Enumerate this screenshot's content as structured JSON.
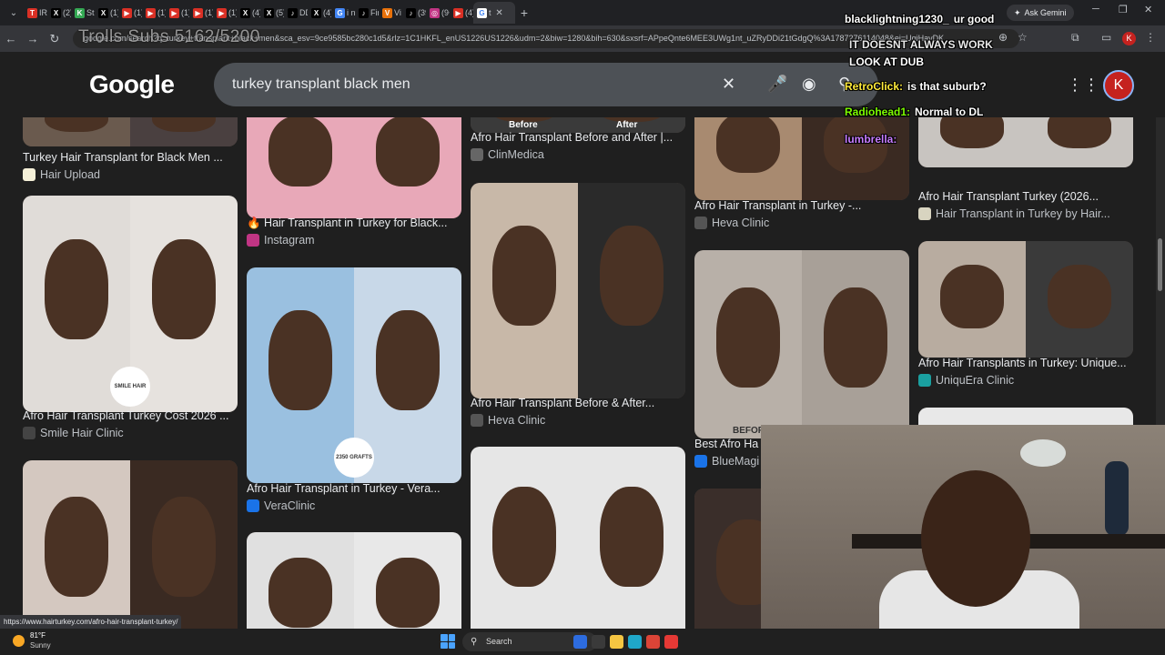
{
  "browser": {
    "tabs": [
      {
        "label": "IRLTo",
        "color": "#d93025",
        "glyph": "T"
      },
      {
        "label": "(2) H",
        "color": "#000000",
        "glyph": "X"
      },
      {
        "label": "St",
        "color": "#34a853",
        "glyph": "K"
      },
      {
        "label": "(1)",
        "color": "#000000",
        "glyph": "X"
      },
      {
        "label": "(1) H",
        "color": "#d93025",
        "glyph": "▶"
      },
      {
        "label": "(1)",
        "color": "#d93025",
        "glyph": "▶"
      },
      {
        "label": "(1) D",
        "color": "#d93025",
        "glyph": "▶"
      },
      {
        "label": "(1) Sh",
        "color": "#d93025",
        "glyph": "▶"
      },
      {
        "label": "(1) D",
        "color": "#d93025",
        "glyph": "▶"
      },
      {
        "label": "(4) D",
        "color": "#000000",
        "glyph": "X"
      },
      {
        "label": "(5) D",
        "color": "#000000",
        "glyph": "X"
      },
      {
        "label": "DDG",
        "color": "#000000",
        "glyph": "♪"
      },
      {
        "label": "(4) le",
        "color": "#000000",
        "glyph": "X"
      },
      {
        "label": "i nee",
        "color": "#4285f4",
        "glyph": "G"
      },
      {
        "label": "Find",
        "color": "#000000",
        "glyph": "♪"
      },
      {
        "label": "Vi",
        "color": "#e8710a",
        "glyph": "V"
      },
      {
        "label": "(39)",
        "color": "#000000",
        "glyph": "♪"
      },
      {
        "label": "(9+)",
        "color": "#c13584",
        "glyph": "◎"
      },
      {
        "label": "(4) D",
        "color": "#d93025",
        "glyph": "▶"
      }
    ],
    "active_tab": {
      "label": "t",
      "glyph": "G"
    },
    "gemini_label": "Ask Gemini",
    "url": "google.com/search?q=turkey+transplant+black+men&sca_esv=9ce9585bc280c1d5&rlz=1C1HKFL_enUS1226US1226&udm=2&biw=1280&bih=630&sxsrf=APpeQnte6MEE3UWg1nt_uZRyDDi21tGdgQ%3A1787276114048&ei=UqiHavDK",
    "profile_initial": "K"
  },
  "overlay": {
    "subs_text": "Trolls Subs 5162/5200",
    "chat": [
      {
        "user": "blacklightning1230_",
        "msg": "ur good",
        "user_color": "#ffffff",
        "msg_color": "#ffffff"
      },
      {
        "user": "",
        "msg": "IT DOESNT ALWAYS WORK",
        "user_color": "#ffffff",
        "msg_color": "#e8e8e8"
      },
      {
        "user": "",
        "msg": "LOOK AT DUB",
        "user_color": "#ffffff",
        "msg_color": "#ffffff"
      },
      {
        "user": "RetroClick:",
        "msg": "is that suburb?",
        "user_color": "#ffeb3b",
        "msg_color": "#ffffff"
      },
      {
        "user": "Radiohead1:",
        "msg": "Normal to DL",
        "user_color": "#7CFC00",
        "msg_color": "#ffffff"
      },
      {
        "user": "lumbrella:",
        "msg": "",
        "user_color": "#c77dff",
        "msg_color": "#ffffff"
      }
    ]
  },
  "google": {
    "logo": "Google",
    "query": "turkey transplant black men",
    "clear_icon": "✕",
    "mic_icon": "🎤",
    "lens_icon": "◉",
    "apps_icon": "⋮⋮⋮",
    "avatar": "K"
  },
  "results": [
    {
      "caption": "Turkey Hair Transplant for Black Men ...",
      "source": "Hair Upload",
      "src_color": "#f5f0d8",
      "tones": [
        "#6a5a4e",
        "#4a4040"
      ]
    },
    {
      "caption": "Afro Hair Transplant Turkey Cost 2026 ...",
      "source": "Smile Hair Clinic",
      "src_color": "#444444",
      "tones": [
        "#e0dcd8",
        "#e6e2de"
      ],
      "badge": "SMILE HAIR CLINIC"
    },
    {
      "caption": "",
      "source": "",
      "src_color": "#000000",
      "tones": [
        "#d4c8c0",
        "#3a2a22"
      ]
    },
    {
      "caption": "🔥 Hair Transplant in Turkey for Black...",
      "source": "Instagram",
      "src_color": "#c13584",
      "tones": [
        "#e8a8b8",
        "#e8a8b8"
      ]
    },
    {
      "caption": "Afro Hair Transplant in Turkey - Vera...",
      "source": "VeraClinic",
      "src_color": "#1a73e8",
      "tones": [
        "#9ac0e0",
        "#c8d8e8"
      ],
      "badge": "2350 GRAFTS"
    },
    {
      "caption": "",
      "source": "",
      "src_color": "#000000",
      "tones": [
        "#e0e0e0",
        "#e8e8e8"
      ]
    },
    {
      "caption": "Afro Hair Transplant Before and After |...",
      "source": "ClinMedica",
      "src_color": "#666666",
      "tones": [
        "#3a3a3a",
        "#3a3a3a"
      ],
      "labels": [
        "Before",
        "After"
      ]
    },
    {
      "caption": "Afro Hair Transplant Before & After...",
      "source": "Heva Clinic",
      "src_color": "#555555",
      "tones": [
        "#c8b8a8",
        "#2a2a2a"
      ]
    },
    {
      "caption": "",
      "source": "",
      "src_color": "#000000",
      "tones": [
        "#e6e6e6",
        "#e6e6e6"
      ]
    },
    {
      "caption": "Afro Hair Transplant in Turkey -...",
      "source": "Heva Clinic",
      "src_color": "#555555",
      "tones": [
        "#a88a70",
        "#3a2a22"
      ]
    },
    {
      "caption": "Best Afro Ha",
      "source": "BlueMagi",
      "src_color": "#1a73e8",
      "tones": [
        "#b8b0a8",
        "#a8a098"
      ],
      "labels": [
        "BEFORE",
        "AFTER"
      ]
    },
    {
      "caption": "",
      "source": "",
      "src_color": "#000000",
      "tones": [
        "#3a2e2a",
        "#2a2a2a"
      ]
    },
    {
      "caption": "Afro Hair Transplant Turkey (2026...",
      "source": "Hair Transplant in Turkey by Hair...",
      "src_color": "#d8d4c0",
      "tones": [
        "#c8c4c0",
        "#c8c4c0"
      ]
    },
    {
      "caption": "Afro Hair Transplants in Turkey: Unique...",
      "source": "UniquEra Clinic",
      "src_color": "#1aa0a0",
      "tones": [
        "#b8aca0",
        "#3a3a3a"
      ]
    },
    {
      "caption": "",
      "source": "",
      "src_color": "#000000",
      "tones": [
        "#e8e8e8",
        "#e8e8e8"
      ]
    }
  ],
  "status_url": "https://www.hairturkey.com/afro-hair-transplant-turkey/",
  "taskbar": {
    "temp": "81°F",
    "condition": "Sunny",
    "search_label": "Search",
    "apps": [
      {
        "name": "widgets",
        "color": "#2d6cdf"
      },
      {
        "name": "task-view",
        "color": "#3a3a3a"
      },
      {
        "name": "file-explorer",
        "color": "#f4c542"
      },
      {
        "name": "edge",
        "color": "#1fa7c9"
      },
      {
        "name": "chrome",
        "color": "#db4437"
      },
      {
        "name": "app-red",
        "color": "#e53935"
      }
    ]
  }
}
